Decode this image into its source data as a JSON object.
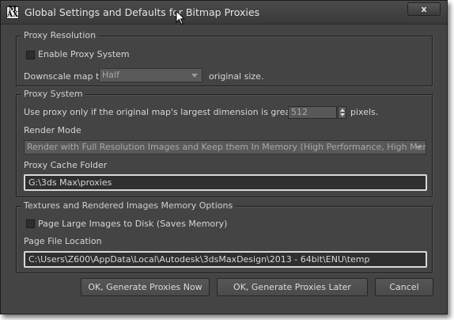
{
  "window": {
    "title": "Global Settings and Defaults for Bitmap Proxies",
    "app_icon_letters": [
      "M",
      "AX"
    ],
    "close_symbol": "x",
    "icons": {
      "app": "3dsmax-app-icon",
      "cursor": "mouse-cursor-icon",
      "close": "close-icon"
    }
  },
  "proxy_resolution": {
    "legend": "Proxy Resolution",
    "enable_label": "Enable Proxy System",
    "enable_checked": false,
    "downscale_label": "Downscale map to",
    "downscale_value": "Half",
    "downscale_suffix": "original size."
  },
  "proxy_system": {
    "legend": "Proxy System",
    "threshold_label": "Use proxy only if the original map's largest dimension is greater than",
    "threshold_value": "512",
    "threshold_unit": "pixels.",
    "render_mode_label": "Render Mode",
    "render_mode_value": "Render with Full Resolution Images and Keep them In Memory (High Performance, High Memory)",
    "cache_folder_label": "Proxy Cache Folder",
    "cache_folder_value": "G:\\3ds Max\\proxies"
  },
  "memory_options": {
    "legend": "Textures and Rendered Images Memory Options",
    "page_large_label": "Page Large Images to Disk (Saves Memory)",
    "page_large_checked": false,
    "page_file_label": "Page File Location",
    "page_file_value": "C:\\Users\\Z600\\AppData\\Local\\Autodesk\\3dsMaxDesign\\2013 - 64bit\\ENU\\temp"
  },
  "buttons": {
    "generate_now": "OK, Generate Proxies Now",
    "generate_later": "OK, Generate Proxies Later",
    "cancel": "Cancel"
  },
  "colors": {
    "dialog_bg": "#444444",
    "field_border_highlight": "#d8d8d8",
    "text": "#d6d6d6"
  }
}
